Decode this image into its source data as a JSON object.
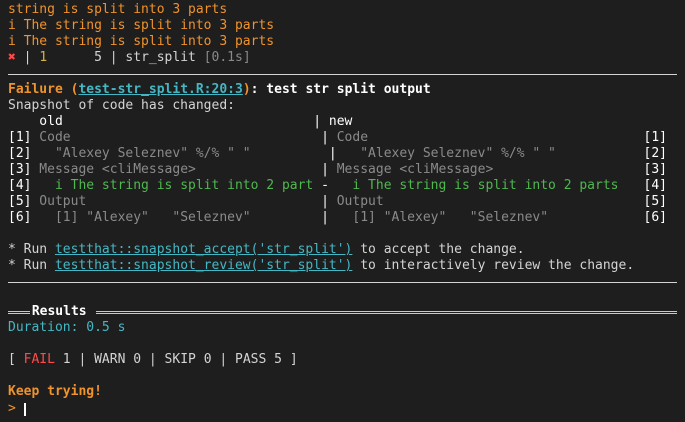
{
  "top": {
    "line1": "string is split into 3 parts",
    "line2_prefix": "i",
    "line2_text": " The string is split into 3 parts",
    "line3_prefix": "i",
    "line3_text": " The string is split into 3 parts",
    "status_fail_icon": "✖",
    "status_pipe": " | ",
    "status_fail_count": "1",
    "status_pass_count": "      5",
    "status_pipe2": " | ",
    "status_name": "str_split",
    "status_time": " [0.1s]"
  },
  "failure": {
    "label": "Failure",
    "open_paren": " (",
    "location": "test-str_split.R:20:3",
    "close_paren": ")",
    "title": ": test str split output",
    "message": "Snapshot of code has changed:"
  },
  "diff": {
    "header": "    old                                | new",
    "rows": [
      {
        "lnum": "[1]",
        "left": " Code                                ",
        "sep": "|",
        "right": " Code",
        "rnum": "[1]",
        "type": "muted"
      },
      {
        "lnum": "[2]",
        "left": "   \"Alexey Seleznev\" %/% \" \"          ",
        "sep": "|",
        "right": "   \"Alexey Seleznev\" %/% \" \"",
        "rnum": "[2]",
        "type": "muted"
      },
      {
        "lnum": "[3]",
        "left": " Message <cliMessage>                ",
        "sep": "|",
        "right": " Message <cliMessage>",
        "rnum": "[3]",
        "type": "muted"
      },
      {
        "lnum": "[4]",
        "left": "   i The string is split into 2 part ",
        "sep": "-",
        "right": "   i The string is split into 2 parts",
        "rnum": "[4]",
        "type": "green"
      },
      {
        "lnum": "[5]",
        "left": " Output                              ",
        "sep": "|",
        "right": " Output",
        "rnum": "[5]",
        "type": "muted"
      },
      {
        "lnum": "[6]",
        "left": "   [1] \"Alexey\"   \"Seleznev\"         ",
        "sep": "|",
        "right": "   [1] \"Alexey\"   \"Seleznev\"",
        "rnum": "[6]",
        "type": "muted"
      }
    ]
  },
  "hints": {
    "accept_prefix": "* Run ",
    "accept_cmd": "testthat::snapshot_accept('str_split')",
    "accept_suffix": " to accept the change.",
    "review_prefix": "* Run ",
    "review_cmd": "testthat::snapshot_review('str_split')",
    "review_suffix": " to interactively review the change."
  },
  "results": {
    "title": " Results ",
    "duration": "Duration: 0.5 s",
    "summary_open": "[ ",
    "fail_label": "FAIL",
    "fail_count": " 1 ",
    "warn": "| WARN 0 ",
    "skip": "| SKIP 0 ",
    "pass": "| PASS 5 ",
    "summary_close": "]"
  },
  "footer": {
    "message": "Keep trying!",
    "prompt": ">"
  },
  "colors": {
    "background": "#1e1e1e",
    "accent_orange": "#f0932b",
    "success_green": "#4fb84f",
    "link_cyan": "#44b7c4",
    "fail_red": "#ff4a4a"
  }
}
